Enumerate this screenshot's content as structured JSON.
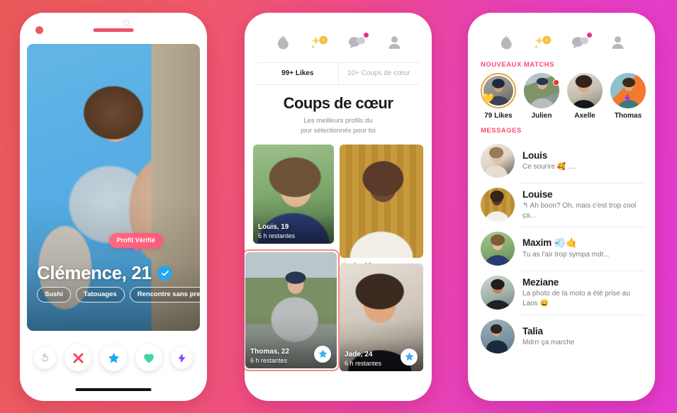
{
  "theme": {
    "bg_left": "#ea5a5a",
    "bg_right": "#e23bcf",
    "accent_pink": "#fd4b72",
    "accent_blue": "#22a7f0",
    "accent_gold": "#c59a45",
    "accent_green": "#4fd8a8",
    "accent_purple": "#8a3df0"
  },
  "phone1": {
    "name": "phone-discover",
    "verified_tooltip": "Profil Vérifié",
    "profile": {
      "name_age": "Clémence, 21",
      "tags": [
        "Sushi",
        "Tatouages",
        "Rencontre sans pression"
      ]
    },
    "actions": [
      {
        "key": "rewind",
        "icon": "rewind-icon",
        "color": "#bdbdbd"
      },
      {
        "key": "nope",
        "icon": "cross-icon",
        "color": "#f4455b"
      },
      {
        "key": "superlike",
        "icon": "star-icon",
        "color": "#1ba7eb"
      },
      {
        "key": "like",
        "icon": "heart-icon",
        "color": "#43d6a3"
      },
      {
        "key": "boost",
        "icon": "lightning-icon",
        "color": "#8a3df0"
      }
    ]
  },
  "nav": {
    "items": [
      {
        "key": "flame",
        "icon": "flame-icon",
        "label": "Découvrir",
        "badge": false
      },
      {
        "key": "top-picks",
        "icon": "sparkle-coin-icon",
        "label": "Coups de cœur",
        "badge": false
      },
      {
        "key": "messages",
        "icon": "chat-bubbles-icon",
        "label": "Messages",
        "badge": true
      },
      {
        "key": "profile",
        "icon": "person-icon",
        "label": "Profil",
        "badge": false
      }
    ]
  },
  "phone2": {
    "name": "phone-top-picks",
    "tabs": [
      {
        "label": "99+ Likes",
        "active": true
      },
      {
        "label": "10+ Coups de cœur",
        "active": false
      }
    ],
    "title": "Coups de cœur",
    "subtitle_line1": "Les meilleurs profils du",
    "subtitle_line2": "jour sélectionnés pour toi",
    "cards": [
      {
        "name": "Louis, 19",
        "time": "6 h restantes",
        "badge_label": "",
        "star": false,
        "highlighted": false
      },
      {
        "name": "",
        "time": "",
        "badge_label": "Créatif",
        "star": true,
        "highlighted": false
      },
      {
        "name": "Thomas, 22",
        "time": "6 h restantes",
        "badge_label": "",
        "star": true,
        "highlighted": true
      },
      {
        "name": "Jade, 24",
        "time": "6 h restantes",
        "badge_label": "",
        "star": true,
        "highlighted": false
      }
    ]
  },
  "phone3": {
    "name": "phone-matches",
    "new_matches_header": "NOUVEAUX MATCHS",
    "messages_header": "MESSAGES",
    "matches": [
      {
        "name": "79 Likes",
        "badge": "heart",
        "ring": true
      },
      {
        "name": "Julien",
        "badge": "dot",
        "ring": false
      },
      {
        "name": "Axelle",
        "badge": "none",
        "ring": false
      },
      {
        "name": "Thomas",
        "badge": "bolt",
        "ring": false
      }
    ],
    "messages": [
      {
        "name": "Louis",
        "preview": "Ce sourire 🥰 ...."
      },
      {
        "name": "Louise",
        "preview": "↰ Ah boon? Oh, mais c'est trop cool ça..."
      },
      {
        "name": "Maxim 💨🤙",
        "preview": "Tu as l'air trop sympa mdr..."
      },
      {
        "name": "Meziane",
        "preview": "La photo de la moto a été prise au Laos 😄"
      },
      {
        "name": "Talia",
        "preview": "Mdrrr ça marche"
      }
    ]
  }
}
